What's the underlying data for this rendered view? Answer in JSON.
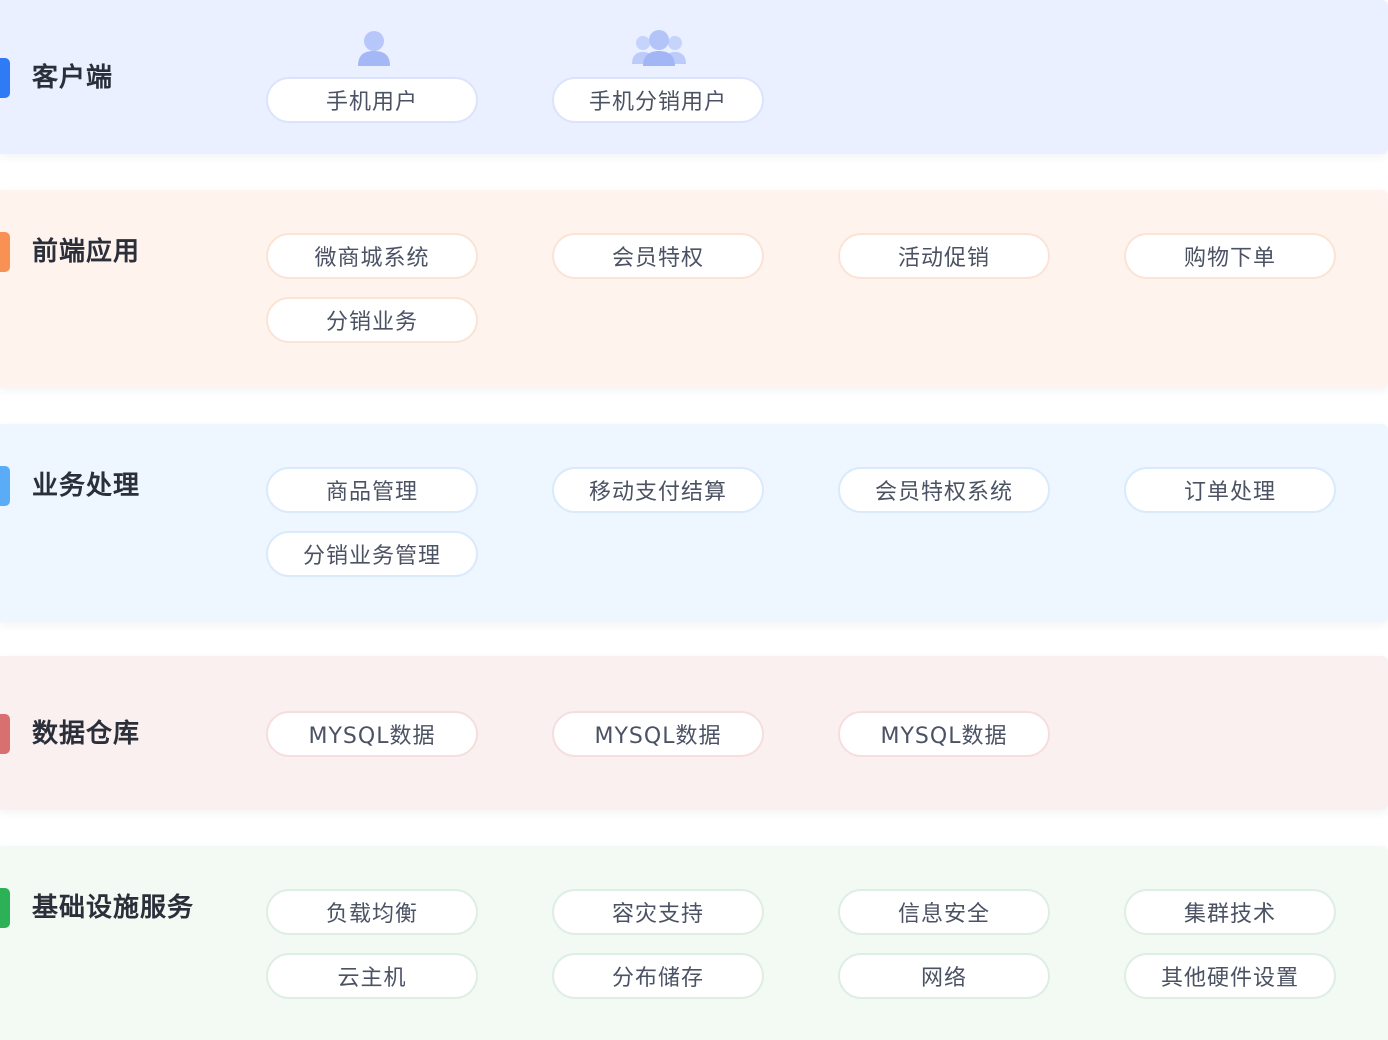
{
  "colors": {
    "client_bg": "#eaf0ff",
    "client_accent": "#2f7bf6",
    "client_border": "#dbe4fb",
    "frontend_bg": "#fff3ee",
    "frontend_accent": "#f89154",
    "frontend_border": "#fbe4d6",
    "business_bg": "#eef6ff",
    "business_accent": "#5aacf7",
    "business_border": "#d9eafb",
    "warehouse_bg": "#fbf0f0",
    "warehouse_accent": "#d97070",
    "warehouse_border": "#f7dede",
    "infra_bg": "#f3faf4",
    "infra_accent": "#2db157",
    "infra_border": "#dfeee2",
    "icon_fill": "#a9bcf7"
  },
  "layers": [
    {
      "title": "客户端",
      "icons": [
        "user-icon",
        "users-group-icon"
      ],
      "items": [
        "手机用户",
        "手机分销用户"
      ]
    },
    {
      "title": "前端应用",
      "items": [
        "微商城系统",
        "会员特权",
        "活动促销",
        "购物下单",
        "分销业务"
      ]
    },
    {
      "title": "业务处理",
      "items": [
        "商品管理",
        "移动支付结算",
        "会员特权系统",
        "订单处理",
        "分销业务管理"
      ]
    },
    {
      "title": "数据仓库",
      "items": [
        "MYSQL数据",
        "MYSQL数据",
        "MYSQL数据"
      ]
    },
    {
      "title": "基础设施服务",
      "items": [
        "负载均衡",
        "容灾支持",
        "信息安全",
        "集群技术",
        "云主机",
        "分布储存",
        "网络",
        "其他硬件设置"
      ]
    }
  ]
}
